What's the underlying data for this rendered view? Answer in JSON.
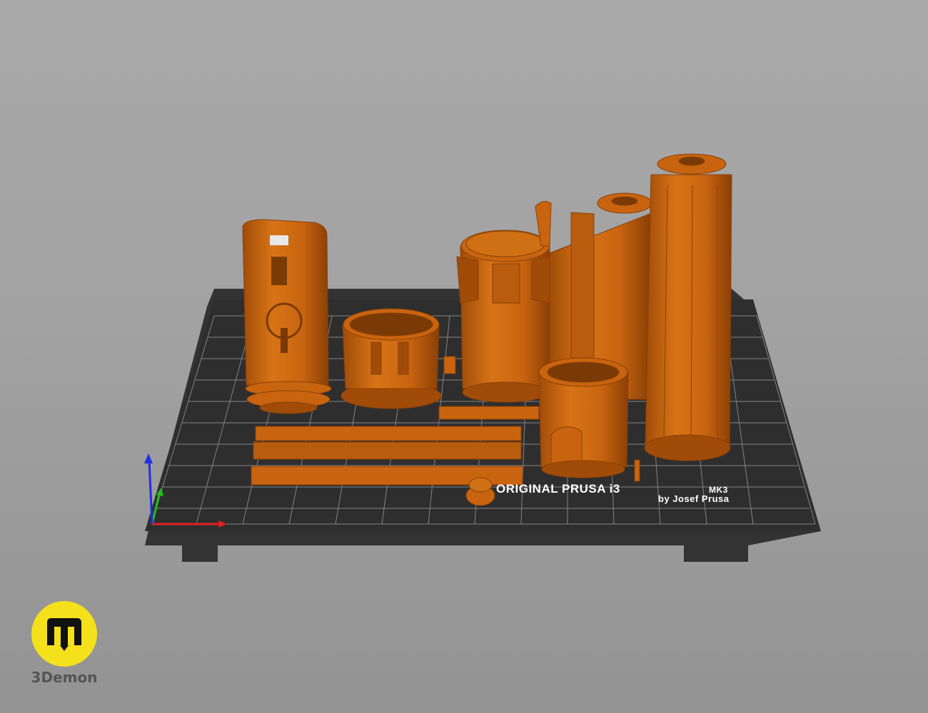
{
  "viewport": {
    "background": "#a4a4a4",
    "print_bed": {
      "color": "#333333",
      "grid_color": "#9a9a9a",
      "label_line1": "ORIGINAL PRUSA i3",
      "label_model": "MK3",
      "label_line2": "by Josef Prusa"
    },
    "model_color": "#c86410",
    "axes": {
      "x_color": "#e02020",
      "y_color": "#20c020",
      "z_color": "#2030e0"
    }
  },
  "brand": {
    "name": "3Demon",
    "logo_color": "#f5e01c",
    "icon": "3demon-logo-icon"
  }
}
